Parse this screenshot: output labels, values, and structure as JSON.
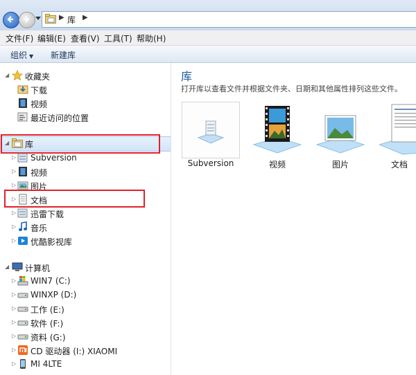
{
  "address": {
    "crumb": "库"
  },
  "menu": [
    "文件(F)",
    "编辑(E)",
    "查看(V)",
    "工具(T)",
    "帮助(H)"
  ],
  "toolbar": {
    "organize": "组织",
    "new_library": "新建库"
  },
  "sidebar": {
    "favorites": {
      "label": "收藏夹",
      "items": [
        "下载",
        "视频",
        "最近访问的位置"
      ]
    },
    "libraries": {
      "label": "库",
      "items": [
        "Subversion",
        "视频",
        "图片",
        "文档",
        "迅雷下载",
        "音乐",
        "优酷影视库"
      ]
    },
    "computer": {
      "label": "计算机",
      "items": [
        "WIN7 (C:)",
        "WINXP (D:)",
        "工作 (E:)",
        "软件 (F:)",
        "资料 (G:)",
        "CD 驱动器 (I:) XIAOMI",
        "MI 4LTE"
      ]
    }
  },
  "content": {
    "title": "库",
    "description": "打开库以查看文件并根据文件夹、日期和其他属性排列这些文件。",
    "tiles": [
      "Subversion",
      "视频",
      "图片",
      "文档"
    ]
  },
  "colors": {
    "accent": "#1e5a96",
    "highlight": "#e2202a",
    "selection": "#d2e4f8"
  }
}
